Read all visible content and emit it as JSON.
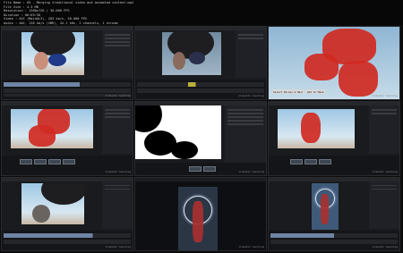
{
  "file_info": {
    "file_name_label": "File Name",
    "file_name": "05 - Merging traditional video and animated content.mp4",
    "file_size_label": "File Size",
    "file_size": "4.3 MB",
    "resolution_label": "Resolution",
    "resolution": "1280x720 / 30.000 FPS",
    "duration_label": "Duration",
    "duration": "00:03:56",
    "video_label": "Video",
    "video": "AVC (Main@L3), 283 kb/s, 30.000 FPS",
    "audio_label": "Audio",
    "audio": "AAC, 128 kb/s (VBR), 44.1 kHz, 2 channels, 1 stream"
  },
  "frames": [
    {
      "watermark": "linkedin learning"
    },
    {
      "watermark": "linkedin learning"
    },
    {
      "badges": [
        "Select Person & Hair",
        "Add to Mask"
      ],
      "watermark": "linkedin learning"
    },
    {
      "watermark": "linkedin learning"
    },
    {
      "watermark": "linkedin learning"
    },
    {
      "watermark": "linkedin learning"
    },
    {
      "watermark": "linkedin learning"
    },
    {
      "watermark": "linkedin learning"
    },
    {
      "watermark": "linkedin learning"
    }
  ]
}
